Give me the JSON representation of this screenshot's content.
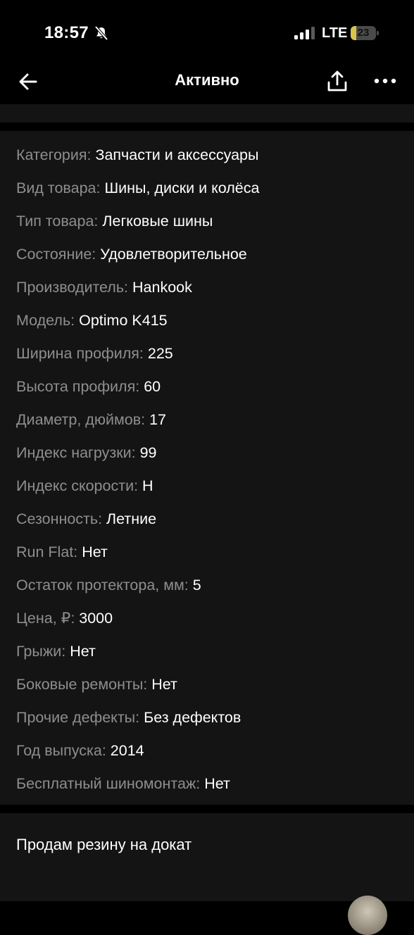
{
  "status_bar": {
    "time": "18:57",
    "network": "LTE",
    "battery": "23",
    "battery_level_percent": 23
  },
  "nav": {
    "title": "Активно",
    "back_icon": "arrow-left-icon",
    "share_icon": "share-icon",
    "more_icon": "more-horizontal-icon"
  },
  "params": [
    {
      "key": "Категория: ",
      "value": "Запчасти и аксессуары"
    },
    {
      "key": "Вид товара: ",
      "value": "Шины, диски и колёса"
    },
    {
      "key": "Тип товара: ",
      "value": "Легковые шины"
    },
    {
      "key": "Состояние: ",
      "value": "Удовлетворительное"
    },
    {
      "key": "Производитель: ",
      "value": "Hankook"
    },
    {
      "key": "Модель: ",
      "value": "Optimo K415"
    },
    {
      "key": "Ширина профиля: ",
      "value": "225"
    },
    {
      "key": "Высота профиля: ",
      "value": "60"
    },
    {
      "key": "Диаметр, дюймов: ",
      "value": "17"
    },
    {
      "key": "Индекс нагрузки: ",
      "value": "99"
    },
    {
      "key": "Индекс скорости: ",
      "value": "H"
    },
    {
      "key": "Сезонность: ",
      "value": "Летние"
    },
    {
      "key": "Run Flat: ",
      "value": "Нет"
    },
    {
      "key": "Остаток протектора, мм: ",
      "value": "5"
    },
    {
      "key": "Цена, ₽: ",
      "value": "3000"
    },
    {
      "key": "Грыжи: ",
      "value": "Нет"
    },
    {
      "key": "Боковые ремонты: ",
      "value": "Нет"
    },
    {
      "key": "Прочие дефекты: ",
      "value": "Без дефектов"
    },
    {
      "key": "Год выпуска: ",
      "value": "2014"
    },
    {
      "key": "Бесплатный шиномонтаж: ",
      "value": "Нет"
    }
  ],
  "description": {
    "text": "Продам резину на докат"
  },
  "colors": {
    "background": "#000000",
    "card": "#141414",
    "key_text": "#8e8e8e",
    "value_text": "#ffffff",
    "battery_fill": "#d9c34a"
  }
}
